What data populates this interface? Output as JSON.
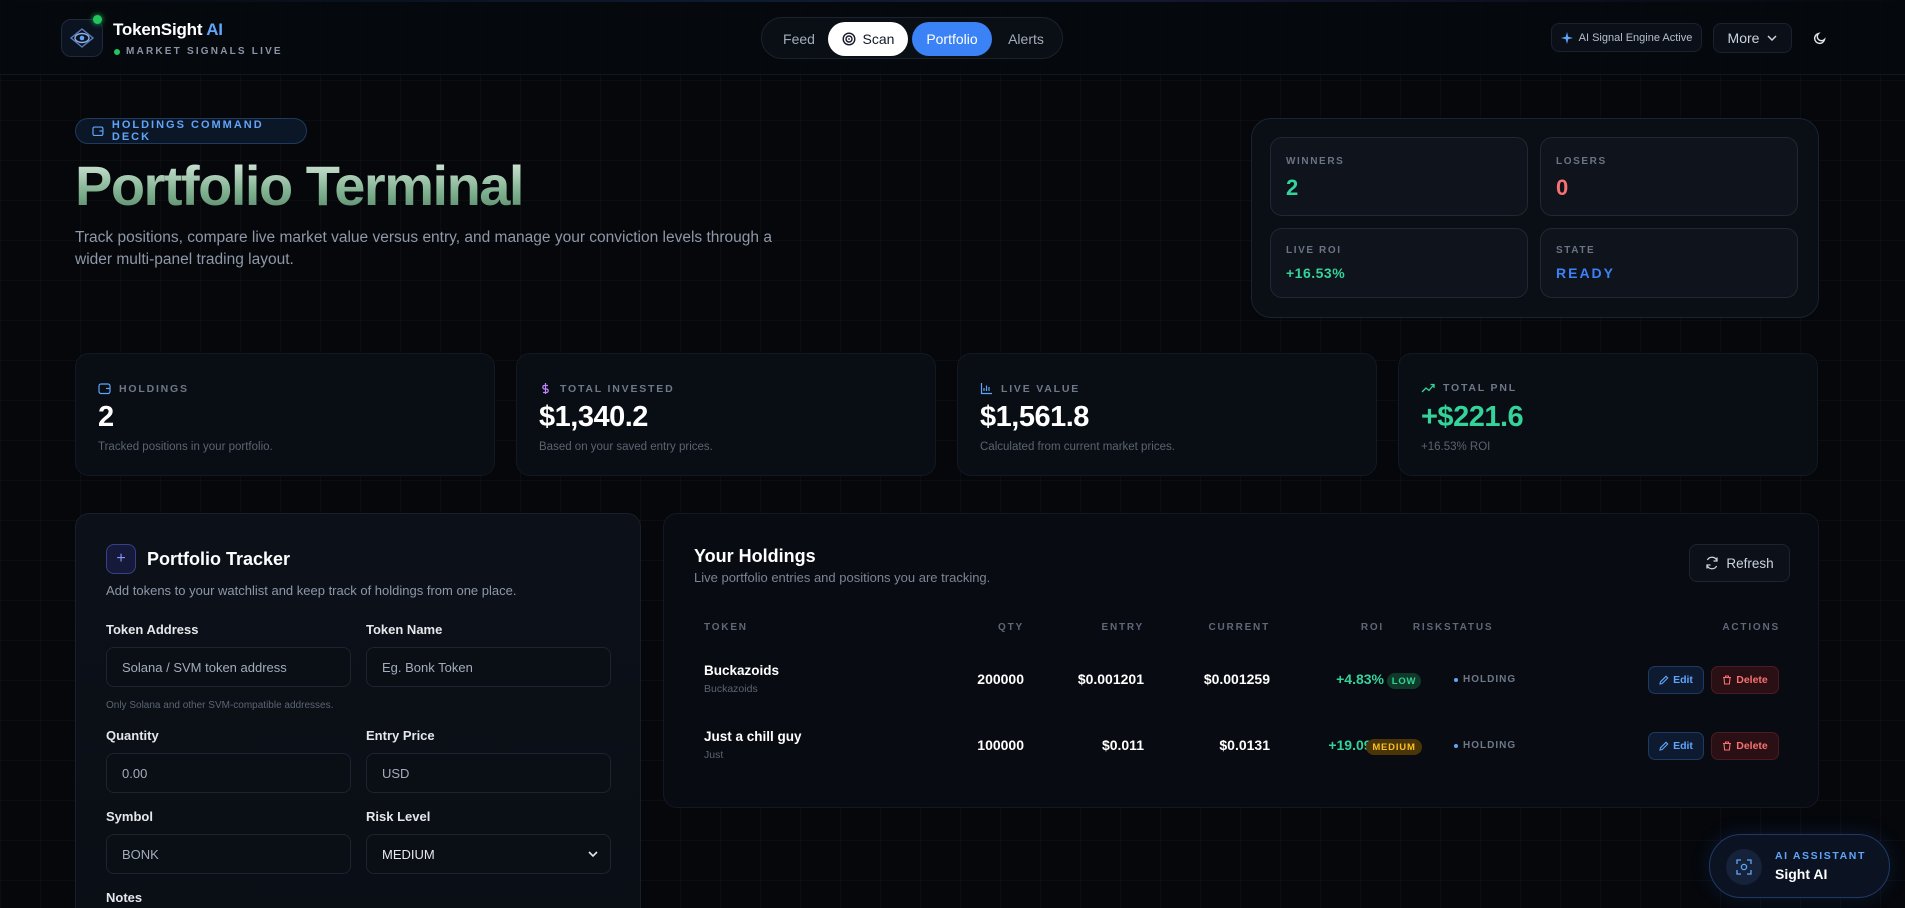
{
  "header": {
    "brand_name": "TokenSight",
    "brand_suffix": "AI",
    "tagline": "MARKET SIGNALS LIVE",
    "nav": {
      "feed": "Feed",
      "scan": "Scan",
      "portfolio": "Portfolio",
      "alerts": "Alerts"
    },
    "engine_status": "AI Signal Engine Active",
    "more_label": "More"
  },
  "hero": {
    "pill": "HOLDINGS COMMAND DECK",
    "title": "Portfolio Terminal",
    "description": "Track positions, compare live market value versus entry, and manage your conviction levels through a wider multi-panel trading layout."
  },
  "summary": {
    "winners_label": "WINNERS",
    "winners_value": "2",
    "losers_label": "LOSERS",
    "losers_value": "0",
    "roi_label": "LIVE ROI",
    "roi_value": "+16.53%",
    "state_label": "STATE",
    "state_value": "READY"
  },
  "metrics": [
    {
      "label": "HOLDINGS",
      "value": "2",
      "sub": "Tracked positions in your portfolio.",
      "icon": "wallet-icon"
    },
    {
      "label": "TOTAL INVESTED",
      "value": "$1,340.2",
      "sub": "Based on your saved entry prices.",
      "icon": "dollar-icon"
    },
    {
      "label": "LIVE VALUE",
      "value": "$1,561.8",
      "sub": "Calculated from current market prices.",
      "icon": "bar-chart-icon"
    },
    {
      "label": "TOTAL PNL",
      "value": "+$221.6",
      "sub": "+16.53% ROI",
      "icon": "trending-up-icon"
    }
  ],
  "tracker": {
    "title": "Portfolio Tracker",
    "description": "Add tokens to your watchlist and keep track of holdings from one place.",
    "token_address_label": "Token Address",
    "token_address_placeholder": "Solana / SVM token address",
    "token_address_hint": "Only Solana and other SVM-compatible addresses.",
    "token_name_label": "Token Name",
    "token_name_placeholder": "Eg. Bonk Token",
    "quantity_label": "Quantity",
    "quantity_placeholder": "0.00",
    "entry_price_label": "Entry Price",
    "entry_price_placeholder": "USD",
    "symbol_label": "Symbol",
    "symbol_placeholder": "BONK",
    "risk_level_label": "Risk Level",
    "risk_level_value": "MEDIUM",
    "notes_label": "Notes"
  },
  "holdings": {
    "title": "Your Holdings",
    "description": "Live portfolio entries and positions you are tracking.",
    "refresh_label": "Refresh",
    "columns": [
      "TOKEN",
      "QTY",
      "ENTRY",
      "CURRENT",
      "ROI",
      "RISK",
      "STATUS",
      "ACTIONS"
    ],
    "rows": [
      {
        "name": "Buckazoids",
        "symbol": "Buckazoids",
        "qty": "200000",
        "entry": "$0.001201",
        "current": "$0.001259",
        "roi": "+4.83%",
        "risk": "LOW",
        "status": "HOLDING"
      },
      {
        "name": "Just a chill guy",
        "symbol": "Just",
        "qty": "100000",
        "entry": "$0.011",
        "current": "$0.0131",
        "roi": "+19.09%",
        "risk": "MEDIUM",
        "status": "HOLDING"
      }
    ],
    "edit_label": "Edit",
    "delete_label": "Delete"
  },
  "assistant": {
    "label": "AI ASSISTANT",
    "name": "Sight AI"
  },
  "colors": {
    "accent": "#3b82f6",
    "positive": "#34d399",
    "negative": "#f87171",
    "warning": "#fbbf24",
    "background": "#05070b"
  }
}
